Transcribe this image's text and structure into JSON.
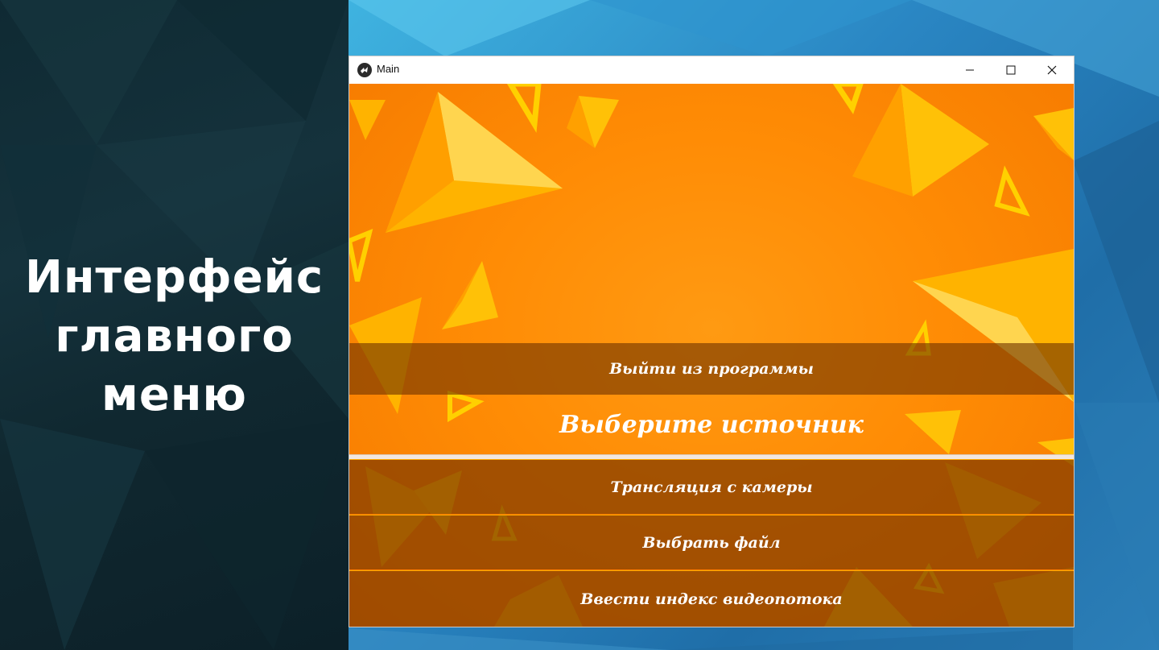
{
  "slide": {
    "title_lines": [
      "Интерфейс",
      "главного",
      "меню"
    ]
  },
  "window": {
    "title": "Main",
    "controls": {
      "minimize": "–",
      "maximize": "☐",
      "close": "✕"
    }
  },
  "app": {
    "exit_button": "Выйти из программы",
    "heading": "Выберите источник",
    "sources": {
      "camera": "Трансляция с камеры",
      "file": "Выбрать файл",
      "stream_index": "Ввести индекс видеопотока"
    }
  },
  "colors": {
    "background_orange": "#ff8c05",
    "button_overlay": "#803a00",
    "triangle_yellow": "#ffc107",
    "slide_panel": "#15323c",
    "desktop_blue": "#2a86c3"
  }
}
